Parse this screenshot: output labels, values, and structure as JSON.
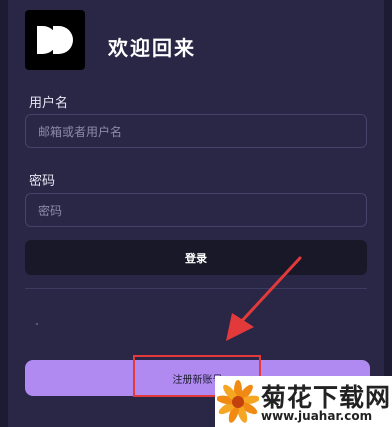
{
  "header": {
    "title": "欢迎回来",
    "logo_icon": "app-logo-icon"
  },
  "form": {
    "username_label": "用户名",
    "username_placeholder": "邮箱或者用户名",
    "password_label": "密码",
    "password_placeholder": "密码",
    "login_label": "登录"
  },
  "register": {
    "label": "注册新账号"
  },
  "watermark": {
    "title": "菊花下载网",
    "url": "www.juahar.com"
  },
  "colors": {
    "background": "#2a2746",
    "login_button": "#191828",
    "register_button": "#b08af0",
    "annotation": "#e23a3a"
  }
}
